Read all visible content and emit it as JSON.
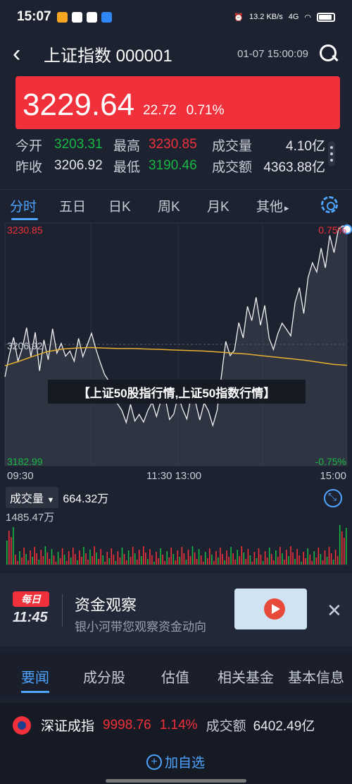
{
  "status_bar": {
    "time": "15:07",
    "network_speed": "13.2 KB/s",
    "network": "4G"
  },
  "header": {
    "title": "上证指数 000001",
    "datetime": "01-07 15:00:09"
  },
  "quote": {
    "price": "3229.64",
    "change": "22.72",
    "change_pct": "0.71%"
  },
  "stats": {
    "rows": [
      [
        {
          "label": "今开",
          "value": "3203.31",
          "color": "green"
        },
        {
          "label": "最高",
          "value": "3230.85",
          "color": "red"
        },
        {
          "label": "成交量",
          "value": "4.10亿",
          "color": "white"
        }
      ],
      [
        {
          "label": "昨收",
          "value": "3206.92",
          "color": "white"
        },
        {
          "label": "最低",
          "value": "3190.46",
          "color": "green"
        },
        {
          "label": "成交额",
          "value": "4363.88亿",
          "color": "white"
        }
      ]
    ]
  },
  "chart_tabs": [
    "分时",
    "五日",
    "日K",
    "周K",
    "月K",
    "其他"
  ],
  "chart_tab_more": "▸",
  "chart": {
    "y_high": "3230.85",
    "y_low": "3182.99",
    "y_base": "3206.92",
    "pct_high": "0.75%",
    "pct_low": "-0.75%",
    "times": [
      "09:30",
      "11:30 13:00",
      "15:00"
    ]
  },
  "overlay_banner": "【上证50股指行情,上证50指数行情】",
  "volume": {
    "selector": "成交量",
    "value": "664.32万",
    "max": "1485.47万"
  },
  "ad": {
    "badge": "每日",
    "badge_time": "11:45",
    "title": "资金观察",
    "subtitle": "银小河带您观察资金动向",
    "close": "✕"
  },
  "sub_tabs": [
    "要闻",
    "成分股",
    "估值",
    "相关基金",
    "基本信息"
  ],
  "ticker": {
    "name": "深证成指",
    "price": "9998.76",
    "pct": "1.14%",
    "vol_label": "成交额",
    "vol_value": "6402.49亿"
  },
  "add_watch": "加自选",
  "colors": {
    "up": "#f0303a",
    "down": "#17b843",
    "accent": "#4ea4ff",
    "avg_line": "#e8b030"
  },
  "chart_data": {
    "type": "line",
    "ylim": [
      3182.99,
      3230.85
    ],
    "series": [
      {
        "values": [
          3200.5,
          3204.8,
          3208.3,
          3203.6,
          3206.1,
          3210.2,
          3204.5,
          3209.3,
          3201.7,
          3207.8,
          3203.9,
          3210.0,
          3205.2,
          3207.1,
          3204.6,
          3205.6,
          3203.6,
          3208.1,
          3204.5,
          3206.8,
          3209.1,
          3206.0,
          3203.4,
          3201.0,
          3199.7,
          3195.6,
          3195.2,
          3193.9,
          3191.5,
          3195.1,
          3191.8,
          3193.1,
          3191.6,
          3193.9,
          3195.5,
          3192.7,
          3195.8,
          3196.4,
          3192.1,
          3193.2,
          3196.9,
          3194.2,
          3192.2,
          3196.7,
          3195.5,
          3192.0,
          3195.4,
          3193.8,
          3190.9,
          3193.9,
          3200.8,
          3207.5,
          3204.7,
          3205.8,
          3211.2,
          3208.2,
          3214.4,
          3211.6,
          3216.2,
          3210.7,
          3214.6,
          3208.1,
          3205.9,
          3209.0,
          3211.1,
          3209.9,
          3208.6,
          3215.2,
          3218.1,
          3213.0,
          3220.1,
          3223.0,
          3221.2,
          3225.9,
          3222.0,
          3228.4,
          3225.0,
          3229.6,
          3230.3,
          3229.6
        ]
      },
      {
        "values": [
          3202.7,
          3203.6,
          3204.6,
          3205.5,
          3206.0,
          3206.2,
          3206.3,
          3206.2,
          3206.1,
          3206.1,
          3206.0,
          3205.9,
          3205.8,
          3205.7,
          3205.6,
          3205.4,
          3205.2,
          3205.0,
          3204.7,
          3204.4,
          3204.1,
          3203.8,
          3203.4,
          3203.0,
          3202.8
        ]
      }
    ]
  }
}
